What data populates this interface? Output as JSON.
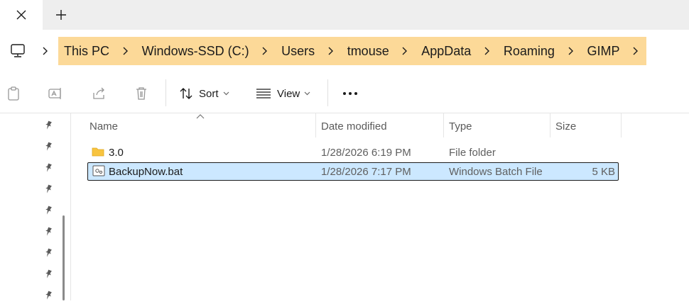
{
  "tabs": {
    "close_icon": "close-icon",
    "new_tab_icon": "plus-icon"
  },
  "address": {
    "root_icon": "monitor-icon",
    "crumbs": [
      "This PC",
      "Windows-SSD (C:)",
      "Users",
      "tmouse",
      "AppData",
      "Roaming",
      "GIMP"
    ],
    "highlight_color": "#fcd998"
  },
  "toolbar": {
    "sort_label": "Sort",
    "view_label": "View",
    "disabled_icons": [
      "paste-icon",
      "rename-icon",
      "share-icon",
      "delete-icon"
    ],
    "more_icon": "more-icon"
  },
  "navpane": {
    "pin_count": 9,
    "pin_icon": "pin-icon"
  },
  "columns": {
    "name": "Name",
    "date": "Date modified",
    "type": "Type",
    "size": "Size"
  },
  "files": [
    {
      "name": "3.0",
      "date": "1/28/2026 6:19 PM",
      "type": "File folder",
      "size": "",
      "icon": "folder-icon",
      "selected": false
    },
    {
      "name": "BackupNow.bat",
      "date": "1/28/2026 7:17 PM",
      "type": "Windows Batch File",
      "size": "5 KB",
      "icon": "batch-file-icon",
      "selected": true
    }
  ],
  "colors": {
    "selection": "#cce8ff",
    "folder": "#f8c440"
  }
}
